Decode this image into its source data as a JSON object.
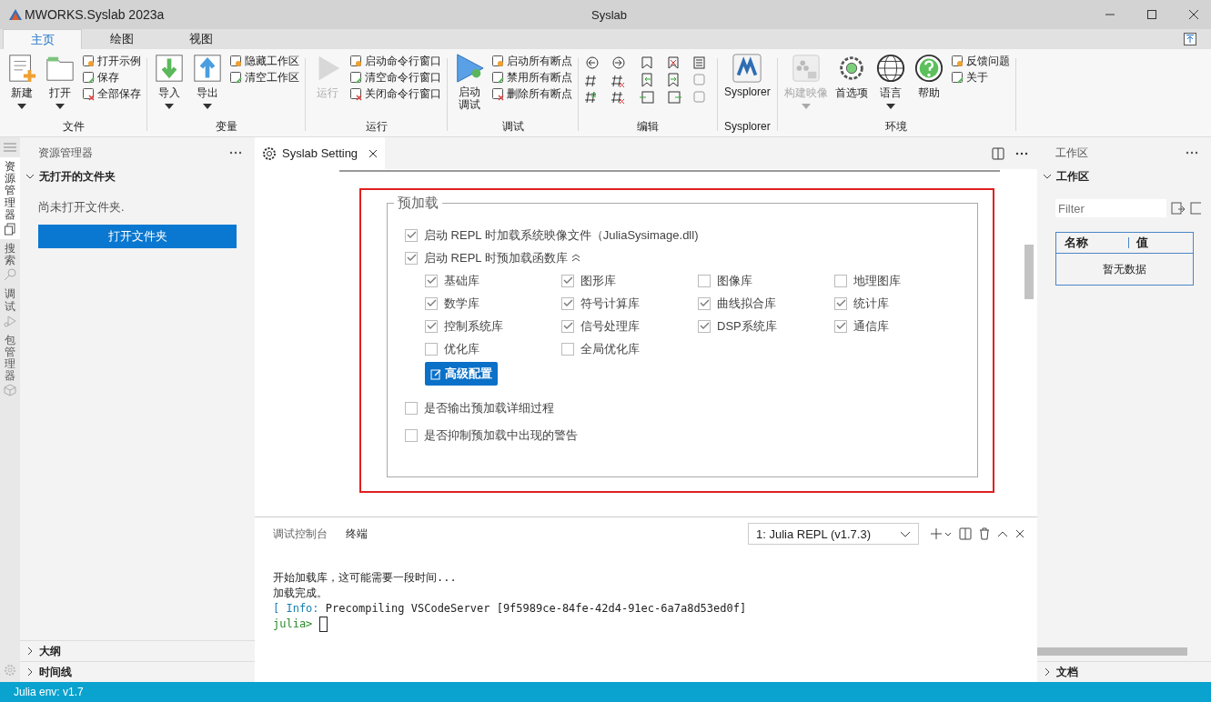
{
  "window": {
    "app_title": "MWORKS.Syslab 2023a",
    "title": "Syslab"
  },
  "ribbon": {
    "tabs": [
      {
        "label": "主页",
        "selected": true
      },
      {
        "label": "绘图",
        "selected": false
      },
      {
        "label": "视图",
        "selected": false
      }
    ],
    "groups": [
      {
        "label": "文件",
        "kind": "buttons",
        "large": [
          {
            "label": "新建",
            "dropdown": true,
            "disabled": false
          },
          {
            "label": "打开",
            "dropdown": true,
            "disabled": false
          }
        ],
        "small": [
          "打开示例",
          "保存",
          "全部保存"
        ]
      },
      {
        "label": "变量",
        "kind": "buttons",
        "large": [
          {
            "label": "导入",
            "dropdown": true,
            "disabled": false
          },
          {
            "label": "导出",
            "dropdown": true,
            "disabled": false
          }
        ],
        "small": [
          "隐藏工作区",
          "清空工作区"
        ]
      },
      {
        "label": "运行",
        "kind": "buttons",
        "large": [
          {
            "label": "运行",
            "dropdown": false,
            "disabled": true
          }
        ],
        "small": [
          "启动命令行窗口",
          "清空命令行窗口",
          "关闭命令行窗口"
        ]
      },
      {
        "label": "调试",
        "kind": "buttons",
        "large": [
          {
            "label": "启动调试",
            "dropdown": false,
            "disabled": false
          }
        ],
        "small": [
          "启动所有断点",
          "禁用所有断点",
          "删除所有断点"
        ]
      },
      {
        "label": "编辑",
        "kind": "icon-grid"
      },
      {
        "label": "Sysplorer",
        "kind": "buttons",
        "large": [
          {
            "label": "Sysplorer",
            "dropdown": false,
            "disabled": false
          }
        ]
      },
      {
        "label": "环境",
        "kind": "buttons",
        "large": [
          {
            "label": "构建映像",
            "dropdown": true,
            "disabled": true
          },
          {
            "label": "首选项",
            "dropdown": false,
            "disabled": false
          },
          {
            "label": "语言",
            "dropdown": true,
            "disabled": false
          },
          {
            "label": "帮助",
            "dropdown": false,
            "disabled": false
          }
        ],
        "small": [
          "反馈问题",
          "关于"
        ]
      }
    ]
  },
  "activity_bar": [
    {
      "label": "资源管理器",
      "selected": true
    },
    {
      "label": "搜索",
      "selected": false
    },
    {
      "label": "调试",
      "selected": false
    },
    {
      "label": "包管理器",
      "selected": false
    }
  ],
  "explorer": {
    "title": "资源管理器",
    "section": {
      "label": "无打开的文件夹",
      "expanded": true
    },
    "message": "尚未打开文件夹.",
    "button": "打开文件夹",
    "bottom_sections": [
      {
        "label": "大纲",
        "expanded": false
      },
      {
        "label": "时间线",
        "expanded": false
      }
    ]
  },
  "editor": {
    "tab": "Syslab Setting",
    "preload": {
      "legend": "预加载",
      "options": [
        {
          "label": "启动 REPL 时加载系统映像文件（JuliaSysimage.dll)",
          "checked": true,
          "expandable": false
        },
        {
          "label": "启动 REPL 时预加载函数库",
          "checked": true,
          "expandable": true
        }
      ],
      "libraries": [
        {
          "label": "基础库",
          "checked": true
        },
        {
          "label": "图形库",
          "checked": true
        },
        {
          "label": "图像库",
          "checked": false
        },
        {
          "label": "地理图库",
          "checked": false
        },
        {
          "label": "数学库",
          "checked": true
        },
        {
          "label": "符号计算库",
          "checked": true
        },
        {
          "label": "曲线拟合库",
          "checked": true
        },
        {
          "label": "统计库",
          "checked": true
        },
        {
          "label": "控制系统库",
          "checked": true
        },
        {
          "label": "信号处理库",
          "checked": true
        },
        {
          "label": "DSP系统库",
          "checked": true
        },
        {
          "label": "通信库",
          "checked": true
        },
        {
          "label": "优化库",
          "checked": false
        },
        {
          "label": "全局优化库",
          "checked": false
        }
      ],
      "button": "高级配置",
      "extra_options": [
        {
          "label": "是否输出预加载详细过程",
          "checked": false
        },
        {
          "label": "是否抑制预加载中出现的警告",
          "checked": false
        }
      ]
    }
  },
  "panel": {
    "tabs": [
      {
        "label": "调试控制台",
        "selected": false
      },
      {
        "label": "终端",
        "selected": true
      }
    ],
    "terminal_select": "1: Julia REPL (v1.7.3)",
    "lines": [
      {
        "kind": "text",
        "text": "开始加载库，这可能需要一段时间..."
      },
      {
        "kind": "text",
        "text": "加载完成。"
      },
      {
        "kind": "info",
        "prefix": "[ Info:",
        "text": "Precompiling VSCodeServer [9f5989ce-84fe-42d4-91ec-6a7a8d53ed0f]"
      },
      {
        "kind": "prompt",
        "text": "julia>"
      }
    ]
  },
  "workspace": {
    "title": "工作区",
    "section": {
      "label": "工作区",
      "expanded": true
    },
    "filter_placeholder": "Filter",
    "columns": [
      "名称",
      "值"
    ],
    "empty": "暂无数据",
    "bottom_section": {
      "label": "文档",
      "expanded": false
    }
  },
  "status_bar": "Julia env: v1.7"
}
